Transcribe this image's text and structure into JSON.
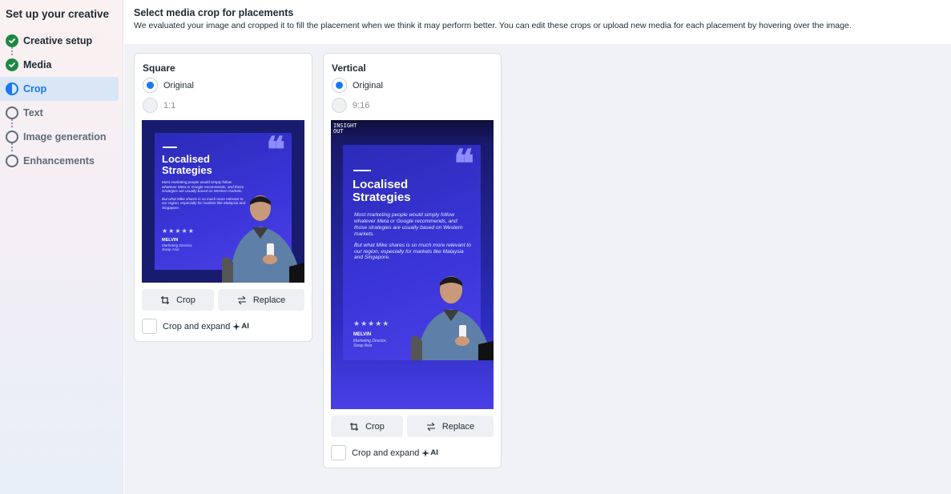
{
  "sidebar": {
    "title": "Set up your creative",
    "steps": [
      {
        "label": "Creative setup",
        "state": "done"
      },
      {
        "label": "Media",
        "state": "done"
      },
      {
        "label": "Crop",
        "state": "active"
      },
      {
        "label": "Text",
        "state": "pending"
      },
      {
        "label": "Image generation",
        "state": "pending"
      },
      {
        "label": "Enhancements",
        "state": "pending"
      }
    ]
  },
  "main": {
    "title": "Select media crop for placements",
    "description": "We evaluated your image and cropped it to fill the placement when we think it may perform better. You can edit these crops or upload new media for each placement by hovering over the image."
  },
  "cards": [
    {
      "title": "Square",
      "options": [
        {
          "label": "Original",
          "selected": true
        },
        {
          "label": "1:1",
          "selected": false
        }
      ],
      "crop_label": "Crop",
      "replace_label": "Replace",
      "expand_label": "Crop and expand",
      "ai_label": "AI"
    },
    {
      "title": "Vertical",
      "options": [
        {
          "label": "Original",
          "selected": true
        },
        {
          "label": "9:16",
          "selected": false
        }
      ],
      "crop_label": "Crop",
      "replace_label": "Replace",
      "expand_label": "Crop and expand",
      "ai_label": "AI"
    }
  ],
  "poster": {
    "headline_1": "Localised",
    "headline_2": "Strategies",
    "body_1": "Most marketing people would simply follow whatever Meta or Google recommends, and those strategies are usually based on Western markets.",
    "body_2": "But what Mike shares is so much more relevant to our region, especially for markets like Malaysia and Singapore.",
    "stars": "★★★★★",
    "name": "MELVIN",
    "role_1": "Marketing Director,",
    "role_2": "Swap Asia",
    "logo_1": "INSIGHT",
    "logo_2": "OUT"
  },
  "colors": {
    "accent": "#1877f2",
    "done": "#1e8742",
    "poster_bg": "#191b6e",
    "poster_panel": "#3a35d8"
  }
}
